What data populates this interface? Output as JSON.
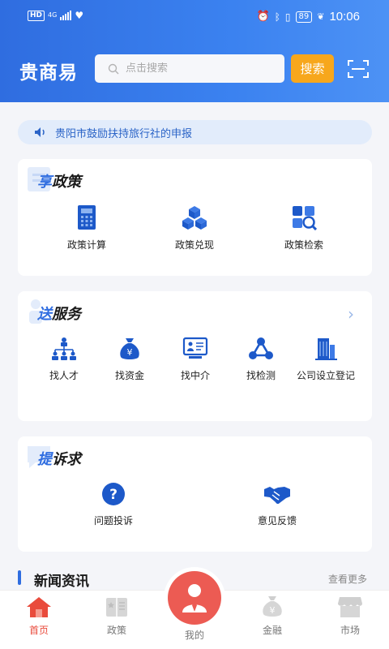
{
  "status": {
    "time": "10:06",
    "battery": "89",
    "network": "HD",
    "signal": "4G"
  },
  "header": {
    "brand": "贵商易",
    "search_placeholder": "点击搜索",
    "search_button": "搜索"
  },
  "notice": {
    "text": "贵阳市鼓励扶持旅行社的申报"
  },
  "policy": {
    "title_first": "享",
    "title_rest": "政策",
    "items": [
      {
        "label": "政策计算"
      },
      {
        "label": "政策兑现"
      },
      {
        "label": "政策检索"
      }
    ]
  },
  "service": {
    "title_first": "送",
    "title_rest": "服务",
    "items": [
      {
        "label": "找人才"
      },
      {
        "label": "找资金"
      },
      {
        "label": "找中介"
      },
      {
        "label": "找检测"
      },
      {
        "label": "公司设立登记"
      }
    ]
  },
  "appeal": {
    "title_first": "提",
    "title_rest": "诉求",
    "items": [
      {
        "label": "问题投诉"
      },
      {
        "label": "意见反馈"
      }
    ]
  },
  "news": {
    "title": "新闻资讯",
    "more": "查看更多"
  },
  "tabs": [
    {
      "label": "首页"
    },
    {
      "label": "政策"
    },
    {
      "label": "我的"
    },
    {
      "label": "金融"
    },
    {
      "label": "市场"
    }
  ],
  "colors": {
    "primary": "#2f6de0",
    "accent": "#f7a71c",
    "active": "#e94b3c"
  }
}
